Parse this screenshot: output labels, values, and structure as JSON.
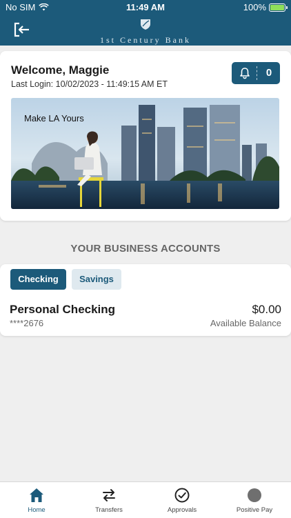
{
  "status_bar": {
    "carrier": "No SIM",
    "time": "11:49 AM",
    "battery": "100%"
  },
  "header": {
    "brand": "1st Century Bank",
    "logout_icon": "logout-icon",
    "accent_color": "#1c5a7a"
  },
  "welcome": {
    "title": "Welcome, Maggie",
    "last_login": "Last Login: 10/02/2023 - 11:49:15 AM ET",
    "notification_count": "0",
    "banner_caption": "Make LA Yours"
  },
  "accounts": {
    "section_title": "YOUR BUSINESS ACCOUNTS",
    "tabs": [
      {
        "label": "Checking",
        "selected": true
      },
      {
        "label": "Savings",
        "selected": false
      }
    ],
    "items": [
      {
        "name": "Personal Checking",
        "number": "****2676",
        "balance": "$0.00",
        "balance_label": "Available Balance"
      }
    ]
  },
  "tabbar": {
    "items": [
      {
        "label": "Home",
        "icon": "home-icon",
        "active": true
      },
      {
        "label": "Transfers",
        "icon": "transfers-icon",
        "active": false
      },
      {
        "label": "Approvals",
        "icon": "approvals-icon",
        "active": false
      },
      {
        "label": "Positive Pay",
        "icon": "positive-pay-icon",
        "active": false
      }
    ]
  }
}
